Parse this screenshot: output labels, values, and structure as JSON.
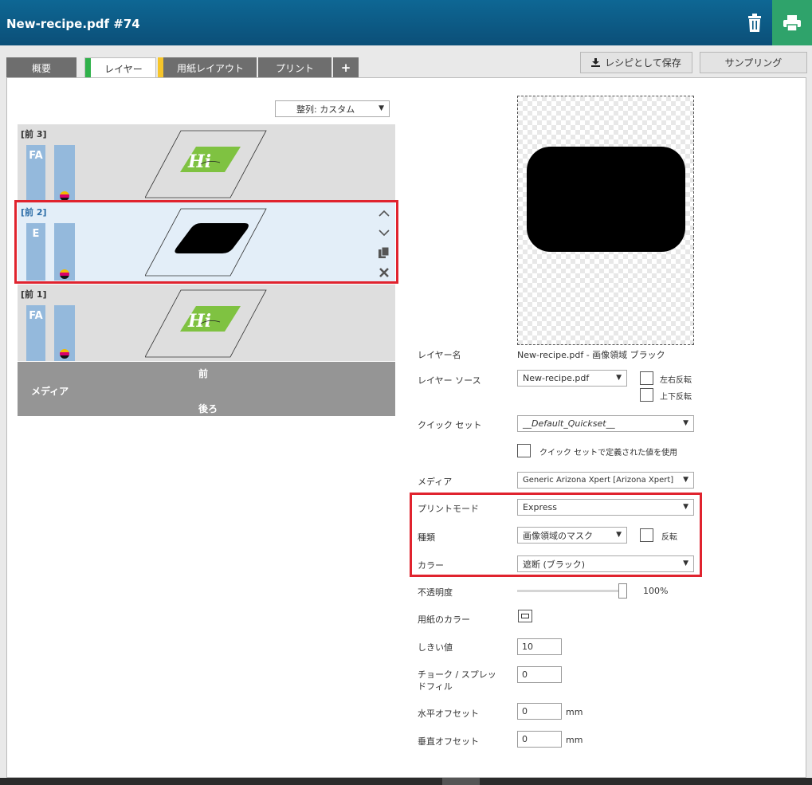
{
  "header": {
    "title": "New-recipe.pdf #74",
    "trash_icon": "trash-icon",
    "print_icon": "printer-icon"
  },
  "tabs": [
    {
      "label": "概要",
      "active": false
    },
    {
      "label": "レイヤー",
      "active": true,
      "marker_color": "#2fb14a"
    },
    {
      "label": "用紙レイアウト",
      "active": false,
      "marker_color": "#f6c52a"
    },
    {
      "label": "プリント",
      "active": false
    },
    {
      "label": "+",
      "active": false
    }
  ],
  "actions": {
    "save_recipe": "レシピとして保存",
    "sampling": "サンプリング"
  },
  "sort": {
    "selected": "整列: カスタム"
  },
  "layers": [
    {
      "name": "[前 3]",
      "badge": "FA",
      "thumbnail": "hi-logo",
      "selected": false
    },
    {
      "name": "[前 2]",
      "badge": "E",
      "thumbnail": "black-shape",
      "selected": true
    },
    {
      "name": "[前 1]",
      "badge": "FA",
      "thumbnail": "hi-logo",
      "selected": false
    }
  ],
  "media_bar": {
    "label": "メディア",
    "front": "前",
    "back": "後ろ"
  },
  "form": {
    "layer_name": {
      "label": "レイヤー名",
      "value": "New-recipe.pdf - 画像領域 ブラック"
    },
    "layer_source": {
      "label": "レイヤー ソース",
      "value": "New-recipe.pdf",
      "mirror_h": "左右反転",
      "mirror_v": "上下反転"
    },
    "quickset": {
      "label": "クイック セット",
      "value": "__Default_Quickset__"
    },
    "use_quickset": {
      "label": "クイック セットで定義された値を使用"
    },
    "media": {
      "label": "メディア",
      "value": "Generic Arizona Xpert [Arizona Xpert]"
    },
    "print_mode": {
      "label": "プリントモード",
      "value": "Express"
    },
    "type": {
      "label": "種類",
      "value": "画像領域のマスク",
      "invert": "反転"
    },
    "color": {
      "label": "カラー",
      "value": "遮断 (ブラック)"
    },
    "opacity": {
      "label": "不透明度",
      "value": "100%",
      "level": 1.0
    },
    "paper_color": {
      "label": "用紙のカラー"
    },
    "threshold": {
      "label": "しきい値",
      "value": "10"
    },
    "choke_spread": {
      "label": "チョーク / スプレッドフィル",
      "value": "0"
    },
    "h_offset": {
      "label": "水平オフセット",
      "value": "0",
      "unit": "mm"
    },
    "v_offset": {
      "label": "垂直オフセット",
      "value": "0",
      "unit": "mm"
    }
  },
  "colors": {
    "header_blue": "#0b5a86",
    "print_green": "#2fa36b",
    "highlight_red": "#e0232e",
    "layer_bar": "#94b9dc",
    "hi_green": "#7fc241"
  }
}
